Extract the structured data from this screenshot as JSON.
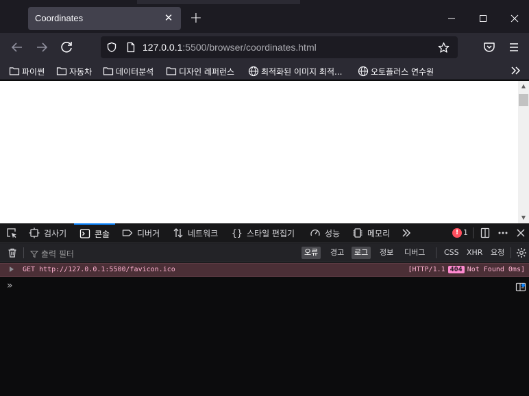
{
  "browser": {
    "tab": {
      "title": "Coordinates",
      "close": "✕"
    },
    "new_tab": "+",
    "window_controls": {
      "minimize": "—",
      "maximize": "☐",
      "close": "✕"
    },
    "url": {
      "host": "127.0.0.1",
      "rest": ":5500/browser/coordinates.html"
    },
    "bookmarks": [
      {
        "label": "파이썬",
        "icon": "folder-icon"
      },
      {
        "label": "자동차",
        "icon": "folder-icon"
      },
      {
        "label": "데이터분석",
        "icon": "folder-icon"
      },
      {
        "label": "디자인 레퍼런스",
        "icon": "folder-icon"
      },
      {
        "label": "최적화된 이미지 최적...",
        "icon": "globe-icon"
      },
      {
        "label": "오토플러스 연수원",
        "icon": "globe-icon"
      }
    ]
  },
  "devtools": {
    "tabs": [
      {
        "label": "검사기",
        "icon": "inspector-icon"
      },
      {
        "label": "콘솔",
        "icon": "console-icon"
      },
      {
        "label": "디버거",
        "icon": "debugger-icon"
      },
      {
        "label": "네트워크",
        "icon": "network-icon"
      },
      {
        "label": "스타일 편집기",
        "icon": "style-editor-icon"
      },
      {
        "label": "성능",
        "icon": "performance-icon"
      },
      {
        "label": "메모리",
        "icon": "memory-icon"
      }
    ],
    "active_tab": "콘솔",
    "error_badge": "!",
    "error_count": "1",
    "filter_placeholder": "출력 필터",
    "filters": {
      "errors": "오류",
      "warnings": "경고",
      "logs": "로그",
      "info": "정보",
      "debug": "디버그",
      "css": "CSS",
      "xhr": "XHR",
      "requests": "요청"
    },
    "message": {
      "text": "GET http://127.0.0.1:5500/favicon.ico",
      "protocol": "[HTTP/1.1",
      "status": "404",
      "status_text": "Not Found 0ms]"
    },
    "prompt": "»"
  },
  "colors": {
    "accent": "#0a84ff",
    "error_row": "#4b2f36",
    "error_badge": "#ff4f5e",
    "status_badge": "#ff8ad0"
  }
}
